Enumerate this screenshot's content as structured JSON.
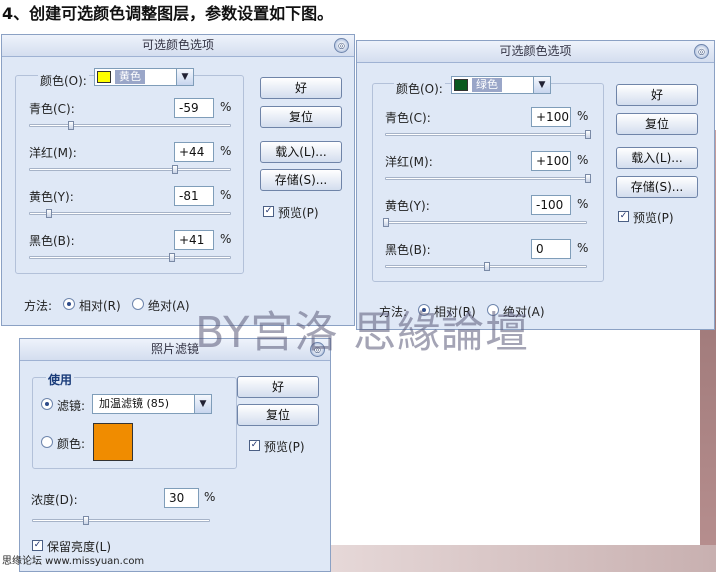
{
  "header": "4、创建可选颜色调整图层，参数设置如下图。",
  "watermark": "BY宫洛 思緣論壇",
  "footer": "思缘论坛 www.missyuan.com",
  "colors": {
    "yellow": "#ffff00",
    "green": "#0a5a1e",
    "orange": "#f08c00",
    "select_blue": "#9aa6c8"
  },
  "dialog1": {
    "title": "可选颜色选项",
    "color_label": "颜色(O):",
    "color_value": "黄色",
    "sliders": [
      {
        "label": "青色(C):",
        "value": "-59",
        "level": -59
      },
      {
        "label": "洋红(M):",
        "value": "+44",
        "level": 44
      },
      {
        "label": "黄色(Y):",
        "value": "-81",
        "level": -81
      },
      {
        "label": "黑色(B):",
        "value": "+41",
        "level": 41
      }
    ],
    "percent": "%",
    "buttons": {
      "ok": "好",
      "reset": "复位",
      "load": "载入(L)...",
      "save": "存储(S)..."
    },
    "preview": "预览(P)",
    "method_label": "方法:",
    "method_relative": "相对(R)",
    "method_absolute": "绝对(A)"
  },
  "dialog2": {
    "title": "可选颜色选项",
    "color_label": "颜色(O):",
    "color_value": "绿色",
    "sliders": [
      {
        "label": "青色(C):",
        "value": "+100",
        "level": 100
      },
      {
        "label": "洋红(M):",
        "value": "+100",
        "level": 100
      },
      {
        "label": "黄色(Y):",
        "value": "-100",
        "level": -100
      },
      {
        "label": "黑色(B):",
        "value": "0",
        "level": 0
      }
    ],
    "percent": "%",
    "buttons": {
      "ok": "好",
      "reset": "复位",
      "load": "载入(L)...",
      "save": "存储(S)..."
    },
    "preview": "预览(P)",
    "method_label": "方法:",
    "method_relative": "相对(R)",
    "method_absolute": "绝对(A)"
  },
  "dialog3": {
    "title": "照片滤镜",
    "use_label": "使用",
    "filter_label": "滤镜:",
    "filter_value": "加温滤镜 (85)",
    "color_label": "颜色:",
    "density_label": "浓度(D):",
    "density_value": "30",
    "density_level": 30,
    "percent": "%",
    "buttons": {
      "ok": "好",
      "reset": "复位"
    },
    "preview": "预览(P)",
    "preserve": "保留亮度(L)"
  }
}
